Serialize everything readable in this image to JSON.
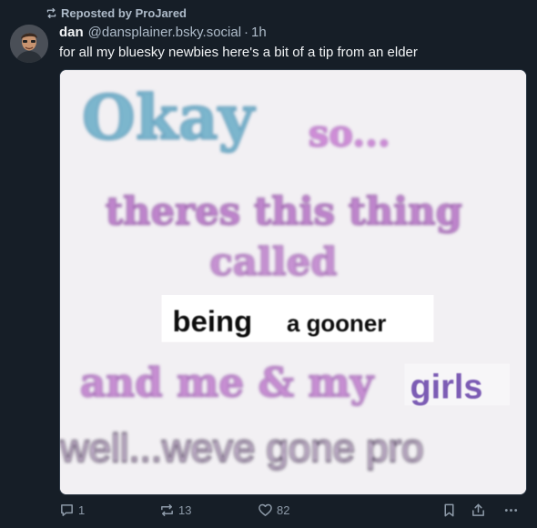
{
  "repost": {
    "label": "Reposted by ProJared",
    "icon": "repost-icon"
  },
  "author": {
    "name": "dan",
    "handle": "@dansplainer.bsky.social",
    "separator": "·",
    "time": "1h"
  },
  "post": {
    "text": "for all my bluesky newbies here's a bit of a tip from an elder"
  },
  "image": {
    "lines": {
      "okay": "Okay",
      "so": "so...",
      "theres": "theres this thing",
      "called": "called",
      "being": "being",
      "gooner": "a gooner",
      "and_me": "and me & my",
      "girls": "girls",
      "well": "well...weve gone pro"
    }
  },
  "actions": {
    "reply": {
      "icon": "reply-icon",
      "count": "1"
    },
    "repost": {
      "icon": "repost-icon",
      "count": "13"
    },
    "like": {
      "icon": "heart-icon",
      "count": "82"
    },
    "bookmark": {
      "icon": "bookmark-icon"
    },
    "share": {
      "icon": "share-icon"
    },
    "more": {
      "icon": "more-icon"
    }
  },
  "colors": {
    "background": "#161e27",
    "secondary_text": "#aebbc9",
    "action_icon": "#8d9aa8"
  }
}
